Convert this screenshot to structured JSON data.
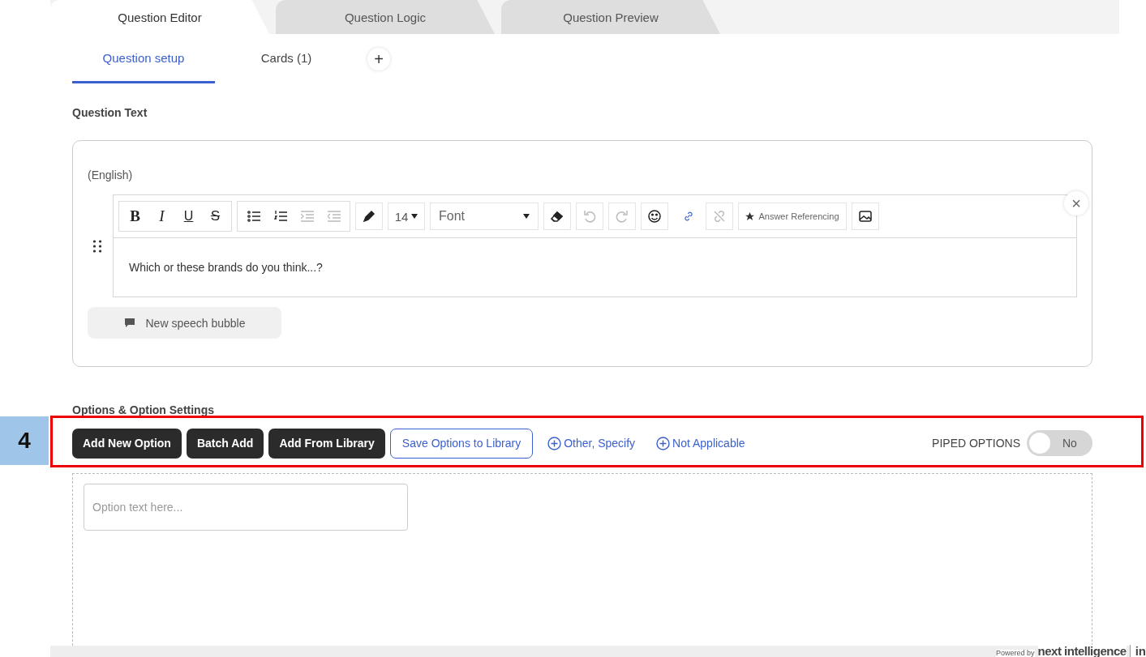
{
  "top_tabs": [
    {
      "label": "Question Editor",
      "selected": true
    },
    {
      "label": "Question Logic",
      "selected": false
    },
    {
      "label": "Question Preview",
      "selected": false
    }
  ],
  "sub_tabs": [
    {
      "label": "Question setup",
      "selected": true
    },
    {
      "label": "Cards (1)",
      "selected": false
    }
  ],
  "add_tab": "+",
  "question_text": {
    "heading": "Question Text",
    "language": "(English)",
    "close": "×",
    "tools": [
      {
        "kind": "bold",
        "label": "B",
        "disabled": false
      },
      {
        "kind": "italic",
        "label": "I",
        "disabled": false
      },
      {
        "kind": "underline",
        "label": "U",
        "disabled": false
      },
      {
        "kind": "strike",
        "label": "S",
        "disabled": false
      },
      {
        "kind": "bullets",
        "disabled": false
      },
      {
        "kind": "numbers",
        "disabled": false
      },
      {
        "kind": "indent",
        "disabled": true
      },
      {
        "kind": "outdent",
        "disabled": true
      },
      {
        "kind": "pen",
        "disabled": false
      },
      {
        "kind": "size",
        "label": "14",
        "disabled": false
      },
      {
        "kind": "font",
        "label": "Font",
        "disabled": false
      },
      {
        "kind": "eraser",
        "disabled": false
      },
      {
        "kind": "undo",
        "disabled": true
      },
      {
        "kind": "redo",
        "disabled": true
      },
      {
        "kind": "emoji",
        "disabled": false
      },
      {
        "kind": "link",
        "disabled": false
      },
      {
        "kind": "unlink",
        "disabled": true
      },
      {
        "kind": "reference",
        "label": "Answer Referencing",
        "disabled": false
      },
      {
        "kind": "image",
        "disabled": false
      }
    ],
    "body": "Which or these brands do you think...?",
    "speech_bubble": "New speech bubble"
  },
  "options": {
    "heading": "Options & Option Settings",
    "buttons": [
      {
        "label": "Add New Option",
        "kind": "dark"
      },
      {
        "label": "Batch Add",
        "kind": "dark"
      },
      {
        "label": "Add From Library",
        "kind": "dark"
      },
      {
        "label": "Save Options to Library",
        "kind": "outline"
      },
      {
        "label": "Other, Specify",
        "kind": "link"
      },
      {
        "label": "Not Applicable",
        "kind": "link"
      }
    ],
    "piped": {
      "label": "PIPED OPTIONS",
      "on": false,
      "state": "No"
    },
    "placeholder": "Option text here..."
  },
  "footer": {
    "powered_by": "Powered by",
    "brand": "next intelligence",
    "suffix": "in"
  },
  "annotation": {
    "number": "4"
  }
}
